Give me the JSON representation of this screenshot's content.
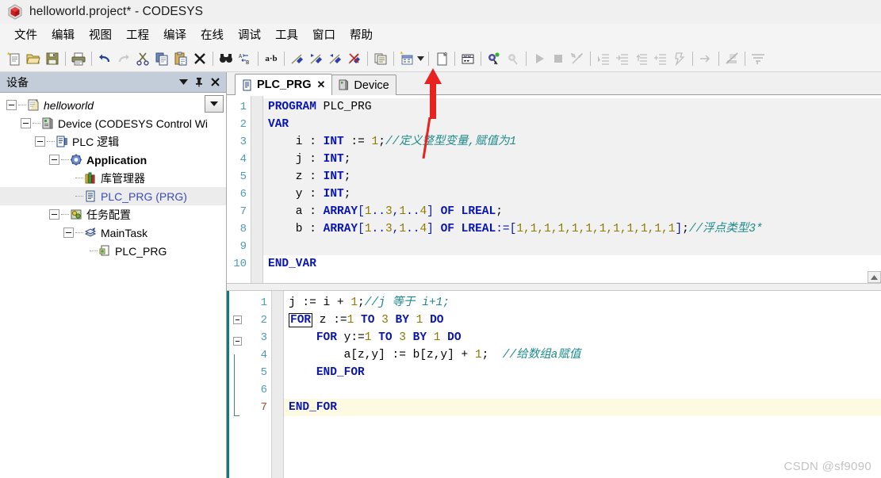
{
  "window": {
    "title": "helloworld.project* - CODESYS",
    "app_icon": "codesys-cube-icon"
  },
  "menubar": {
    "items": [
      {
        "label": "文件",
        "name": "menu-file"
      },
      {
        "label": "编辑",
        "name": "menu-edit"
      },
      {
        "label": "视图",
        "name": "menu-view"
      },
      {
        "label": "工程",
        "name": "menu-project"
      },
      {
        "label": "编译",
        "name": "menu-build"
      },
      {
        "label": "在线",
        "name": "menu-online"
      },
      {
        "label": "调试",
        "name": "menu-debug"
      },
      {
        "label": "工具",
        "name": "menu-tools"
      },
      {
        "label": "窗口",
        "name": "menu-window"
      },
      {
        "label": "帮助",
        "name": "menu-help"
      }
    ]
  },
  "toolbar": {
    "buttons": [
      {
        "name": "new-project-icon",
        "enabled": true
      },
      {
        "name": "open-project-icon",
        "enabled": true
      },
      {
        "name": "save-project-icon",
        "enabled": true
      },
      {
        "name": "separator",
        "enabled": true
      },
      {
        "name": "print-icon",
        "enabled": true
      },
      {
        "name": "separator",
        "enabled": true
      },
      {
        "name": "undo-icon",
        "enabled": true
      },
      {
        "name": "redo-icon",
        "enabled": false
      },
      {
        "name": "cut-icon",
        "enabled": true
      },
      {
        "name": "copy-icon",
        "enabled": true
      },
      {
        "name": "paste-icon",
        "enabled": true
      },
      {
        "name": "delete-icon",
        "enabled": true
      },
      {
        "name": "separator",
        "enabled": true
      },
      {
        "name": "find-icon",
        "enabled": true
      },
      {
        "name": "replace-icon",
        "enabled": true
      },
      {
        "name": "separator",
        "enabled": true
      },
      {
        "name": "ab-label-icon",
        "enabled": true,
        "label": "a·b"
      },
      {
        "name": "separator",
        "enabled": true
      },
      {
        "name": "bookmark-toggle-icon",
        "enabled": true
      },
      {
        "name": "bookmark-next-icon",
        "enabled": true
      },
      {
        "name": "bookmark-prev-icon",
        "enabled": true
      },
      {
        "name": "bookmark-clear-icon",
        "enabled": true
      },
      {
        "name": "separator",
        "enabled": true
      },
      {
        "name": "properties-icon",
        "enabled": true
      },
      {
        "name": "separator",
        "enabled": true
      },
      {
        "name": "add-object-icon",
        "enabled": true
      },
      {
        "name": "add-object-dropdown-caret",
        "enabled": true
      },
      {
        "name": "separator",
        "enabled": true
      },
      {
        "name": "add-folder-icon",
        "enabled": true
      },
      {
        "name": "separator",
        "enabled": true
      },
      {
        "name": "build-icon",
        "enabled": true
      },
      {
        "name": "separator",
        "enabled": true
      },
      {
        "name": "login-icon",
        "enabled": true
      },
      {
        "name": "logout-icon",
        "enabled": false
      },
      {
        "name": "separator",
        "enabled": true
      },
      {
        "name": "run-icon",
        "enabled": false
      },
      {
        "name": "stop-icon",
        "enabled": false
      },
      {
        "name": "debug-config-icon",
        "enabled": false
      },
      {
        "name": "separator",
        "enabled": true
      },
      {
        "name": "step-over-icon",
        "enabled": false
      },
      {
        "name": "step-into-icon",
        "enabled": false
      },
      {
        "name": "step-out-icon",
        "enabled": false
      },
      {
        "name": "run-to-cursor-icon",
        "enabled": false
      },
      {
        "name": "set-next-statement-icon",
        "enabled": false
      },
      {
        "name": "separator",
        "enabled": true
      },
      {
        "name": "show-next-statement-icon",
        "enabled": false
      },
      {
        "name": "separator",
        "enabled": true
      },
      {
        "name": "breakpoint-disable-icon",
        "enabled": false
      },
      {
        "name": "separator",
        "enabled": true
      },
      {
        "name": "flow-control-icon",
        "enabled": false
      }
    ]
  },
  "sidebar": {
    "header": {
      "title": "设备",
      "dropdown_glyph": "▼",
      "pin_glyph": "📌",
      "close_glyph": "✕"
    },
    "tree": [
      {
        "label": "helloworld",
        "style": "italic",
        "depth": 0,
        "expander": "minus",
        "icon": "project-icon",
        "selected": false
      },
      {
        "label": "Device (CODESYS Control Wi",
        "style": "normal",
        "depth": 1,
        "expander": "minus",
        "icon": "device-icon",
        "selected": false
      },
      {
        "label": "PLC 逻辑",
        "style": "normal",
        "depth": 2,
        "expander": "minus",
        "icon": "plc-logic-icon",
        "selected": false
      },
      {
        "label": "Application",
        "style": "bold",
        "depth": 3,
        "expander": "minus",
        "icon": "application-icon",
        "selected": false
      },
      {
        "label": "库管理器",
        "style": "normal",
        "depth": 4,
        "expander": "none",
        "icon": "library-manager-icon",
        "selected": false
      },
      {
        "label": "PLC_PRG (PRG)",
        "style": "blue",
        "depth": 4,
        "expander": "none",
        "icon": "pou-icon",
        "selected": true
      },
      {
        "label": "任务配置",
        "style": "normal",
        "depth": 3,
        "expander": "minus",
        "icon": "task-config-icon",
        "selected": false
      },
      {
        "label": "MainTask",
        "style": "normal",
        "depth": 4,
        "expander": "minus",
        "icon": "task-icon",
        "selected": false
      },
      {
        "label": "PLC_PRG",
        "style": "normal",
        "depth": 5,
        "expander": "none",
        "icon": "task-call-icon",
        "selected": false
      }
    ]
  },
  "editor": {
    "tabs": [
      {
        "label": "PLC_PRG",
        "icon": "pou-icon",
        "active": true,
        "closable": true,
        "close_glyph": "✕"
      },
      {
        "label": "Device",
        "icon": "device-icon",
        "active": false,
        "closable": false
      }
    ],
    "declaration": {
      "line_numbers": [
        "1",
        "2",
        "3",
        "4",
        "5",
        "6",
        "7",
        "8",
        "9",
        "10"
      ],
      "lines": [
        {
          "n": 1,
          "tokens": [
            {
              "t": "PROGRAM",
              "c": "k"
            },
            {
              "t": " PLC_PRG",
              "c": "t"
            }
          ]
        },
        {
          "n": 2,
          "tokens": [
            {
              "t": "VAR",
              "c": "k"
            }
          ]
        },
        {
          "n": 3,
          "tokens": [
            {
              "t": "    i : ",
              "c": "t"
            },
            {
              "t": "INT",
              "c": "k"
            },
            {
              "t": " := ",
              "c": "t"
            },
            {
              "t": "1",
              "c": "n"
            },
            {
              "t": ";",
              "c": "t"
            },
            {
              "t": "//定义整型变量,赋值为1",
              "c": "c"
            }
          ]
        },
        {
          "n": 4,
          "tokens": [
            {
              "t": "    j : ",
              "c": "t"
            },
            {
              "t": "INT",
              "c": "k"
            },
            {
              "t": ";",
              "c": "t"
            }
          ]
        },
        {
          "n": 5,
          "tokens": [
            {
              "t": "    z : ",
              "c": "t"
            },
            {
              "t": "INT",
              "c": "k"
            },
            {
              "t": ";",
              "c": "t"
            }
          ]
        },
        {
          "n": 6,
          "tokens": [
            {
              "t": "    y : ",
              "c": "t"
            },
            {
              "t": "INT",
              "c": "k"
            },
            {
              "t": ";",
              "c": "t"
            }
          ]
        },
        {
          "n": 7,
          "tokens": [
            {
              "t": "    a : ",
              "c": "t"
            },
            {
              "t": "ARRAY",
              "c": "k"
            },
            {
              "t": "[",
              "c": "p"
            },
            {
              "t": "1",
              "c": "n"
            },
            {
              "t": "..",
              "c": "p"
            },
            {
              "t": "3",
              "c": "n"
            },
            {
              "t": ",",
              "c": "p"
            },
            {
              "t": "1",
              "c": "n"
            },
            {
              "t": "..",
              "c": "p"
            },
            {
              "t": "4",
              "c": "n"
            },
            {
              "t": "] ",
              "c": "p"
            },
            {
              "t": "OF LREAL",
              "c": "k"
            },
            {
              "t": ";",
              "c": "t"
            }
          ]
        },
        {
          "n": 8,
          "tokens": [
            {
              "t": "    b : ",
              "c": "t"
            },
            {
              "t": "ARRAY",
              "c": "k"
            },
            {
              "t": "[",
              "c": "p"
            },
            {
              "t": "1",
              "c": "n"
            },
            {
              "t": "..",
              "c": "p"
            },
            {
              "t": "3",
              "c": "n"
            },
            {
              "t": ",",
              "c": "p"
            },
            {
              "t": "1",
              "c": "n"
            },
            {
              "t": "..",
              "c": "p"
            },
            {
              "t": "4",
              "c": "n"
            },
            {
              "t": "] ",
              "c": "p"
            },
            {
              "t": "OF LREAL",
              "c": "k"
            },
            {
              "t": ":=",
              "c": "p"
            },
            {
              "t": "[",
              "c": "p"
            },
            {
              "t": "1,1,1,1,1,1,1,1,1,1,1,1",
              "c": "n"
            },
            {
              "t": "]",
              "c": "p"
            },
            {
              "t": ";",
              "c": "t"
            },
            {
              "t": "//浮点类型3*",
              "c": "c"
            }
          ]
        },
        {
          "n": 9,
          "tokens": []
        },
        {
          "n": 10,
          "tokens": [
            {
              "t": "END_VAR",
              "c": "k"
            }
          ]
        }
      ]
    },
    "implementation": {
      "line_numbers": [
        "1",
        "2",
        "3",
        "4",
        "5",
        "6",
        "7"
      ],
      "lines": [
        {
          "n": 1,
          "fold": "none",
          "highlight": false,
          "tokens": [
            {
              "t": "j := i + ",
              "c": "t"
            },
            {
              "t": "1",
              "c": "n"
            },
            {
              "t": ";",
              "c": "t"
            },
            {
              "t": "//j 等于 i+1;",
              "c": "c"
            }
          ]
        },
        {
          "n": 2,
          "fold": "minus",
          "highlight": false,
          "tokens": [
            {
              "t": "FOR",
              "c": "k boxed"
            },
            {
              "t": " z :=",
              "c": "t"
            },
            {
              "t": "1",
              "c": "n"
            },
            {
              "t": " ",
              "c": "t"
            },
            {
              "t": "TO",
              "c": "k"
            },
            {
              "t": " ",
              "c": "t"
            },
            {
              "t": "3",
              "c": "n"
            },
            {
              "t": " ",
              "c": "t"
            },
            {
              "t": "BY",
              "c": "k"
            },
            {
              "t": " ",
              "c": "t"
            },
            {
              "t": "1",
              "c": "n"
            },
            {
              "t": " ",
              "c": "t"
            },
            {
              "t": "DO",
              "c": "k"
            }
          ]
        },
        {
          "n": 3,
          "fold": "minus",
          "highlight": false,
          "tokens": [
            {
              "t": "    ",
              "c": "t"
            },
            {
              "t": "FOR",
              "c": "k"
            },
            {
              "t": " y:=",
              "c": "t"
            },
            {
              "t": "1",
              "c": "n"
            },
            {
              "t": " ",
              "c": "t"
            },
            {
              "t": "TO",
              "c": "k"
            },
            {
              "t": " ",
              "c": "t"
            },
            {
              "t": "3",
              "c": "n"
            },
            {
              "t": " ",
              "c": "t"
            },
            {
              "t": "BY",
              "c": "k"
            },
            {
              "t": " ",
              "c": "t"
            },
            {
              "t": "1",
              "c": "n"
            },
            {
              "t": " ",
              "c": "t"
            },
            {
              "t": "DO",
              "c": "k"
            }
          ]
        },
        {
          "n": 4,
          "fold": "bar",
          "highlight": false,
          "tokens": [
            {
              "t": "        a[z,y] := b[z,y] + ",
              "c": "t"
            },
            {
              "t": "1",
              "c": "n"
            },
            {
              "t": ";  ",
              "c": "t"
            },
            {
              "t": "//给数组a赋值",
              "c": "c"
            }
          ]
        },
        {
          "n": 5,
          "fold": "bar",
          "highlight": false,
          "tokens": [
            {
              "t": "    ",
              "c": "t"
            },
            {
              "t": "END_FOR",
              "c": "k"
            }
          ]
        },
        {
          "n": 6,
          "fold": "bar",
          "highlight": false,
          "tokens": []
        },
        {
          "n": 7,
          "fold": "foot",
          "highlight": true,
          "tokens": [
            {
              "t": "END_FOR",
              "c": "k"
            }
          ]
        }
      ]
    }
  },
  "watermark": {
    "text": "CSDN @sf9090"
  },
  "colors": {
    "keyword": "#0a16b4",
    "number": "#8d7a00",
    "comment": "#1f8a8a",
    "selection": "#ececec",
    "highlight_line": "#fcfbe2",
    "sidebar_header": "#c3ccd9",
    "annotation_arrow": "#e8231f",
    "fold_bar": "#127878"
  }
}
